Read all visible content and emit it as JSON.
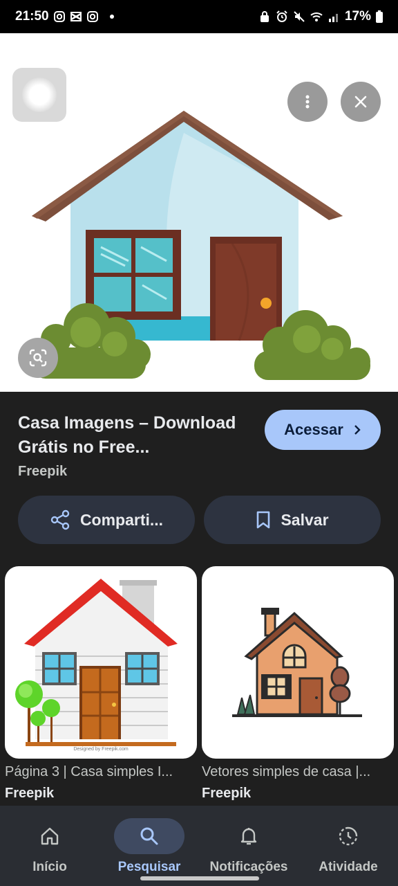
{
  "status_bar": {
    "time": "21:50",
    "battery": "17%",
    "icons": [
      "instagram-icon",
      "capcut-icon",
      "instagram-icon",
      "notification-dot",
      "lock-icon",
      "alarm-icon",
      "mute-icon",
      "wifi-icon",
      "signal-icon",
      "battery-icon"
    ]
  },
  "viewer": {
    "icons": [
      "lens-badge-icon",
      "more-vert-icon",
      "close-icon",
      "lens-search-icon"
    ]
  },
  "result": {
    "title": "Casa Imagens – Download Grátis no Free...",
    "source": "Freepik",
    "visit_label": "Acessar",
    "share_label": "Comparti...",
    "save_label": "Salvar"
  },
  "related": [
    {
      "caption": "Página 3 | Casa simples I...",
      "source": "Freepik",
      "watermark": "Designed by Freepik.com"
    },
    {
      "caption": "Vetores simples de casa |...",
      "source": "Freepik"
    }
  ],
  "nav": {
    "items": [
      {
        "label": "Início",
        "icon": "home-icon"
      },
      {
        "label": "Pesquisar",
        "icon": "search-icon",
        "active": true
      },
      {
        "label": "Notificações",
        "icon": "bell-icon"
      },
      {
        "label": "Atividade",
        "icon": "activity-icon"
      }
    ]
  },
  "colors": {
    "accent": "#a8c7fa",
    "panel": "#1f1f1f",
    "nav_background": "#2a2d33",
    "button_background": "#2d3340"
  }
}
